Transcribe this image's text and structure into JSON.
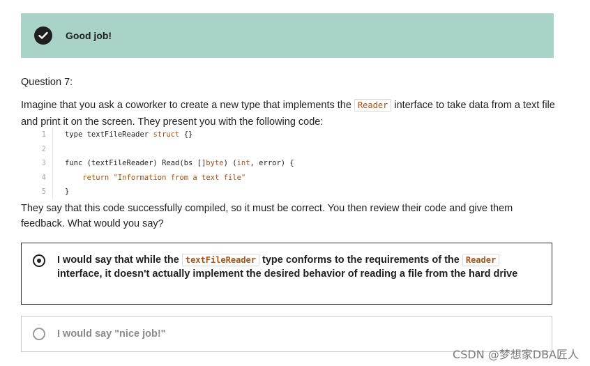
{
  "banner": {
    "title": "Good job!",
    "icon": "check-circle-icon"
  },
  "question": {
    "label": "Question 7:",
    "prompt_before": "Imagine that you ask a coworker to create a new type that implements the ",
    "prompt_code": "Reader",
    "prompt_after": " interface to take data from a text file and print it on the screen.  They present you with the following code:",
    "code_lines": [
      {
        "no": "1",
        "text": "type textFileReader struct {}"
      },
      {
        "no": "2",
        "text": ""
      },
      {
        "no": "3",
        "text": "func (textFileReader) Read(bs []byte) (int, error) {"
      },
      {
        "no": "4",
        "text": "    return \"Information from a text file\""
      },
      {
        "no": "5",
        "text": "}"
      }
    ],
    "followup": "They say that this code successfully compiled, so it must be correct. You then review their code and give them feedback.  What would you say?"
  },
  "options": [
    {
      "selected": true,
      "text_1": "I would say that while the ",
      "code_1": "textFileReader",
      "text_2": " type conforms to the requirements of the ",
      "code_2": "Reader",
      "text_3": " interface, it doesn't actually implement the desired behavior of reading a file from the hard drive"
    },
    {
      "selected": false,
      "text": "I would say \"nice job!\""
    }
  ],
  "watermark": "CSDN @梦想家DBA匠人"
}
